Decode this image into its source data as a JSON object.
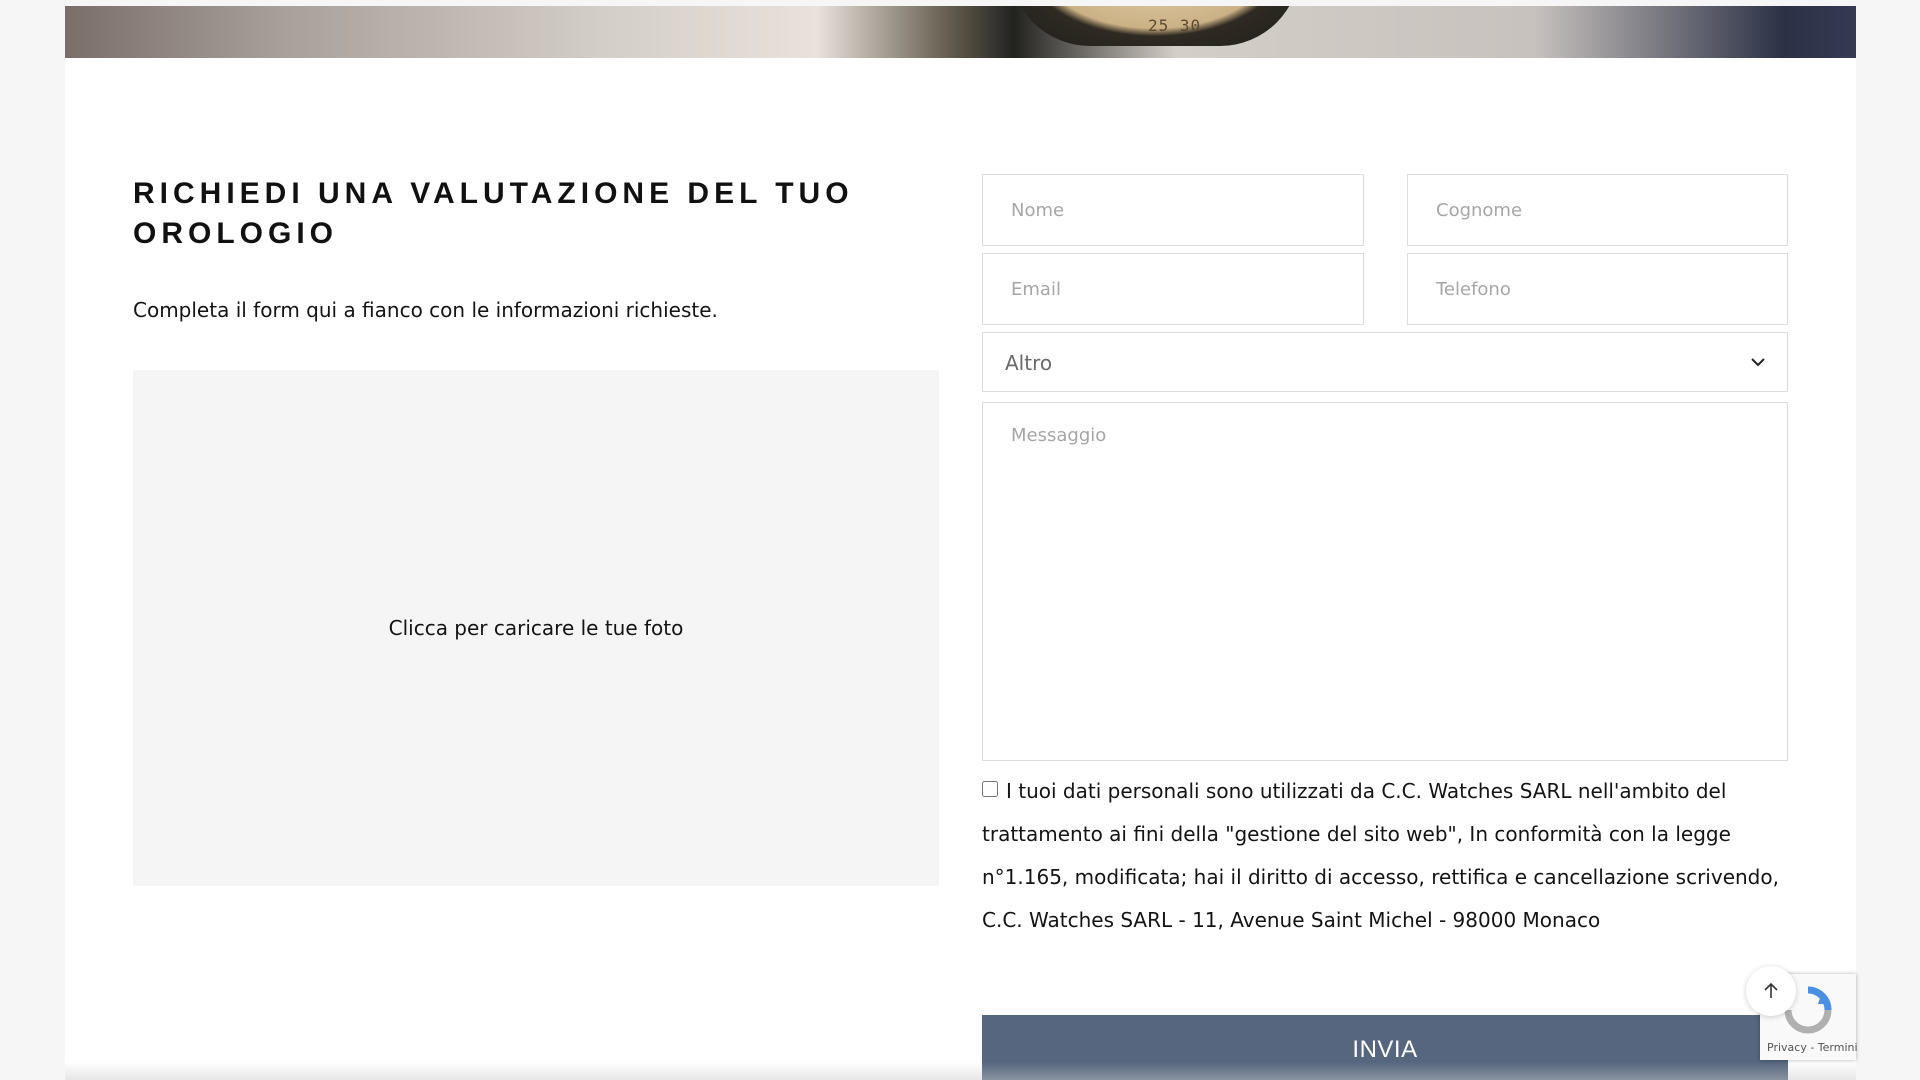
{
  "hero": {
    "dial_text": "25   30"
  },
  "section": {
    "title": "RICHIEDI UNA VALUTAZIONE DEL TUO OROLOGIO",
    "intro": "Completa il form qui a fianco con le informazioni richieste."
  },
  "upload": {
    "label": "Clicca per caricare le tue foto"
  },
  "form": {
    "nome_placeholder": "Nome",
    "cognome_placeholder": "Cognome",
    "email_placeholder": "Email",
    "telefono_placeholder": "Telefono",
    "subject_selected": "Altro",
    "messaggio_placeholder": "Messaggio",
    "consent_text": "I tuoi dati personali sono utilizzati da C.C. Watches SARL nell'ambito del trattamento ai fini della \"gestione del sito web\", In conformità con la legge n°1.165, modificata; hai il diritto di accesso, rettifica e cancellazione scrivendo, C.C. Watches SARL - 11, Avenue Saint Michel - 98000 Monaco",
    "submit_label": "INVIA"
  },
  "recaptcha": {
    "terms": "Privacy - Termini"
  },
  "colors": {
    "button": "#56667f",
    "upload_bg": "#f5f5f5",
    "border": "#dcdcdc"
  },
  "icons": {
    "select_chevron": "chevron-down-icon",
    "back_to_top": "arrow-up-icon",
    "recaptcha": "recaptcha-logo-icon"
  }
}
